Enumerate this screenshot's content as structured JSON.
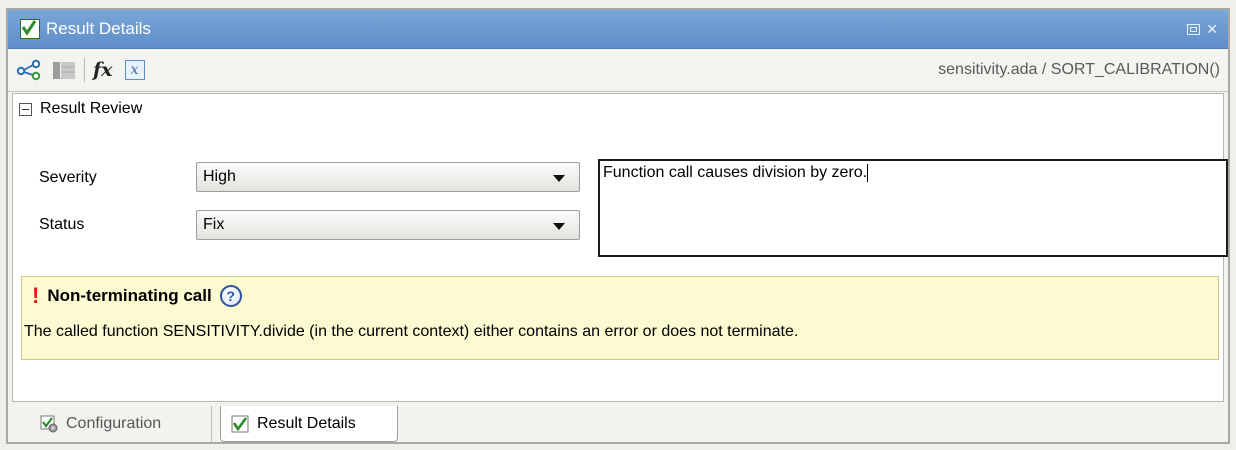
{
  "window": {
    "title": "Result Details",
    "controls": {
      "restore_icon": "restore-icon",
      "close_glyph": "✕"
    }
  },
  "toolbar": {
    "buttons": [
      {
        "name": "call-graph-icon"
      },
      {
        "name": "table-icon"
      },
      {
        "name": "fx-icon",
        "label": "fx"
      },
      {
        "name": "variable-icon",
        "label": "x"
      }
    ],
    "path": "sensitivity.ada / SORT_CALIBRATION()"
  },
  "review": {
    "section_title": "Result Review",
    "severity_label": "Severity",
    "severity_value": "High",
    "status_label": "Status",
    "status_value": "Fix",
    "comment": "Function call causes division by zero."
  },
  "warning": {
    "icon": "!",
    "title": "Non-terminating call",
    "help_glyph": "?",
    "message": "The called function SENSITIVITY.divide (in the current context) either contains an error or does not terminate."
  },
  "tabs": [
    {
      "label": "Configuration",
      "selected": false
    },
    {
      "label": "Result Details",
      "selected": true
    }
  ],
  "colors": {
    "titlebar": "#6b9ad0",
    "warning_bg": "#fbfad0",
    "error_red": "#e01b1b",
    "check_green": "#2c8a2c"
  }
}
